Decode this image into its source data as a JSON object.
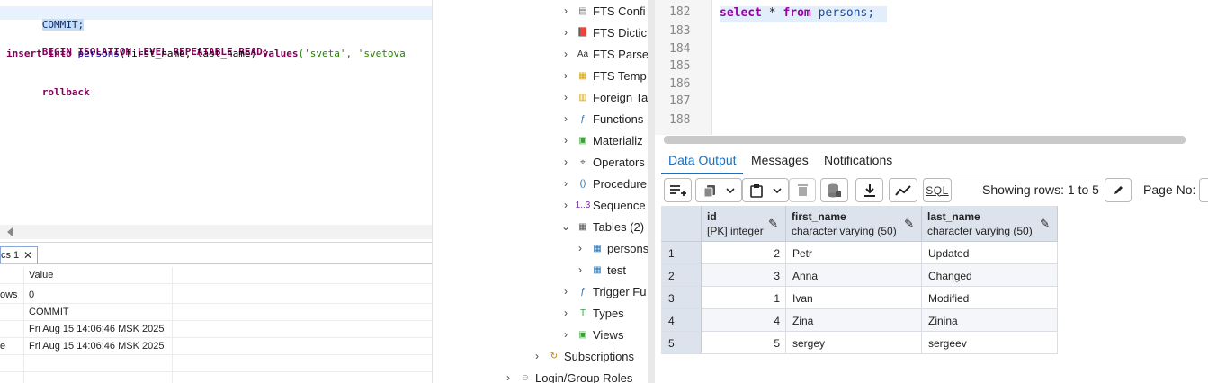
{
  "left_editor": {
    "line1": "COMMIT;",
    "line2_kw": "BEGIN ISOLATION LEVEL REPEATABLE READ;",
    "line3_kw1": "insert into",
    "line3_ident": "persons",
    "line3_cols": "(first_name, last_name)",
    "line3_kw2": "values",
    "line3_vals": "('sveta', 'svetova",
    "line4": "rollback"
  },
  "stats_panel": {
    "tab_label": "cs 1",
    "header_value": "Value",
    "rows": [
      {
        "name": "ows",
        "value": "0"
      },
      {
        "name": "",
        "value": "COMMIT"
      },
      {
        "name": "",
        "value": "Fri Aug 15 14:06:46 MSK 2025"
      },
      {
        "name": "e",
        "value": "Fri Aug 15 14:06:46 MSK 2025"
      }
    ]
  },
  "tree": {
    "items": [
      {
        "label": "FTS Confi",
        "icon": "fts-config-icon"
      },
      {
        "label": "FTS Dictic",
        "icon": "fts-dictionary-icon"
      },
      {
        "label": "FTS Parse",
        "icon": "fts-parser-icon"
      },
      {
        "label": "FTS Temp",
        "icon": "fts-template-icon"
      },
      {
        "label": "Foreign Ta",
        "icon": "foreign-table-icon"
      },
      {
        "label": "Functions",
        "icon": "functions-icon"
      },
      {
        "label": "Materializ",
        "icon": "materialized-view-icon"
      },
      {
        "label": "Operators",
        "icon": "operators-icon"
      },
      {
        "label": "Procedure",
        "icon": "procedures-icon"
      },
      {
        "label": "Sequence",
        "icon": "sequences-icon"
      },
      {
        "label": "Tables (2)",
        "icon": "tables-icon"
      },
      {
        "label": "persons",
        "icon": "table-icon"
      },
      {
        "label": "test",
        "icon": "table-icon"
      },
      {
        "label": "Trigger Fu",
        "icon": "trigger-functions-icon"
      },
      {
        "label": "Types",
        "icon": "types-icon"
      },
      {
        "label": "Views",
        "icon": "views-icon"
      },
      {
        "label": "Subscriptions",
        "icon": "subscriptions-icon"
      },
      {
        "label": "Login/Group Roles",
        "icon": "login-roles-icon"
      }
    ]
  },
  "pg_editor": {
    "line_numbers": [
      "182",
      "183",
      "184",
      "185",
      "186",
      "187",
      "188"
    ],
    "line_182": {
      "kw1": "select",
      "op": "*",
      "kw2": "from",
      "ident": "persons;"
    }
  },
  "result_tabs": [
    "Data Output",
    "Messages",
    "Notifications"
  ],
  "toolbar": {
    "showing": "Showing rows: 1 to 5",
    "page_no": "Page No:",
    "sql_label": "SQL"
  },
  "grid": {
    "columns": [
      {
        "name": "id",
        "type": "[PK] integer"
      },
      {
        "name": "first_name",
        "type": "character varying (50)"
      },
      {
        "name": "last_name",
        "type": "character varying (50)"
      }
    ],
    "rows": [
      {
        "n": "1",
        "id": "2",
        "first_name": "Petr",
        "last_name": "Updated"
      },
      {
        "n": "2",
        "id": "3",
        "first_name": "Anna",
        "last_name": "Changed"
      },
      {
        "n": "3",
        "id": "1",
        "first_name": "Ivan",
        "last_name": "Modified"
      },
      {
        "n": "4",
        "id": "4",
        "first_name": "Zina",
        "last_name": "Zinina"
      },
      {
        "n": "5",
        "id": "5",
        "first_name": "sergey",
        "last_name": "sergeev"
      }
    ]
  },
  "colors": {
    "accent": "#1c6fb8",
    "keyword_left": "#7f0055",
    "keyword_pg": "#9b00a8",
    "tree_selection": "#d9ecf9"
  }
}
